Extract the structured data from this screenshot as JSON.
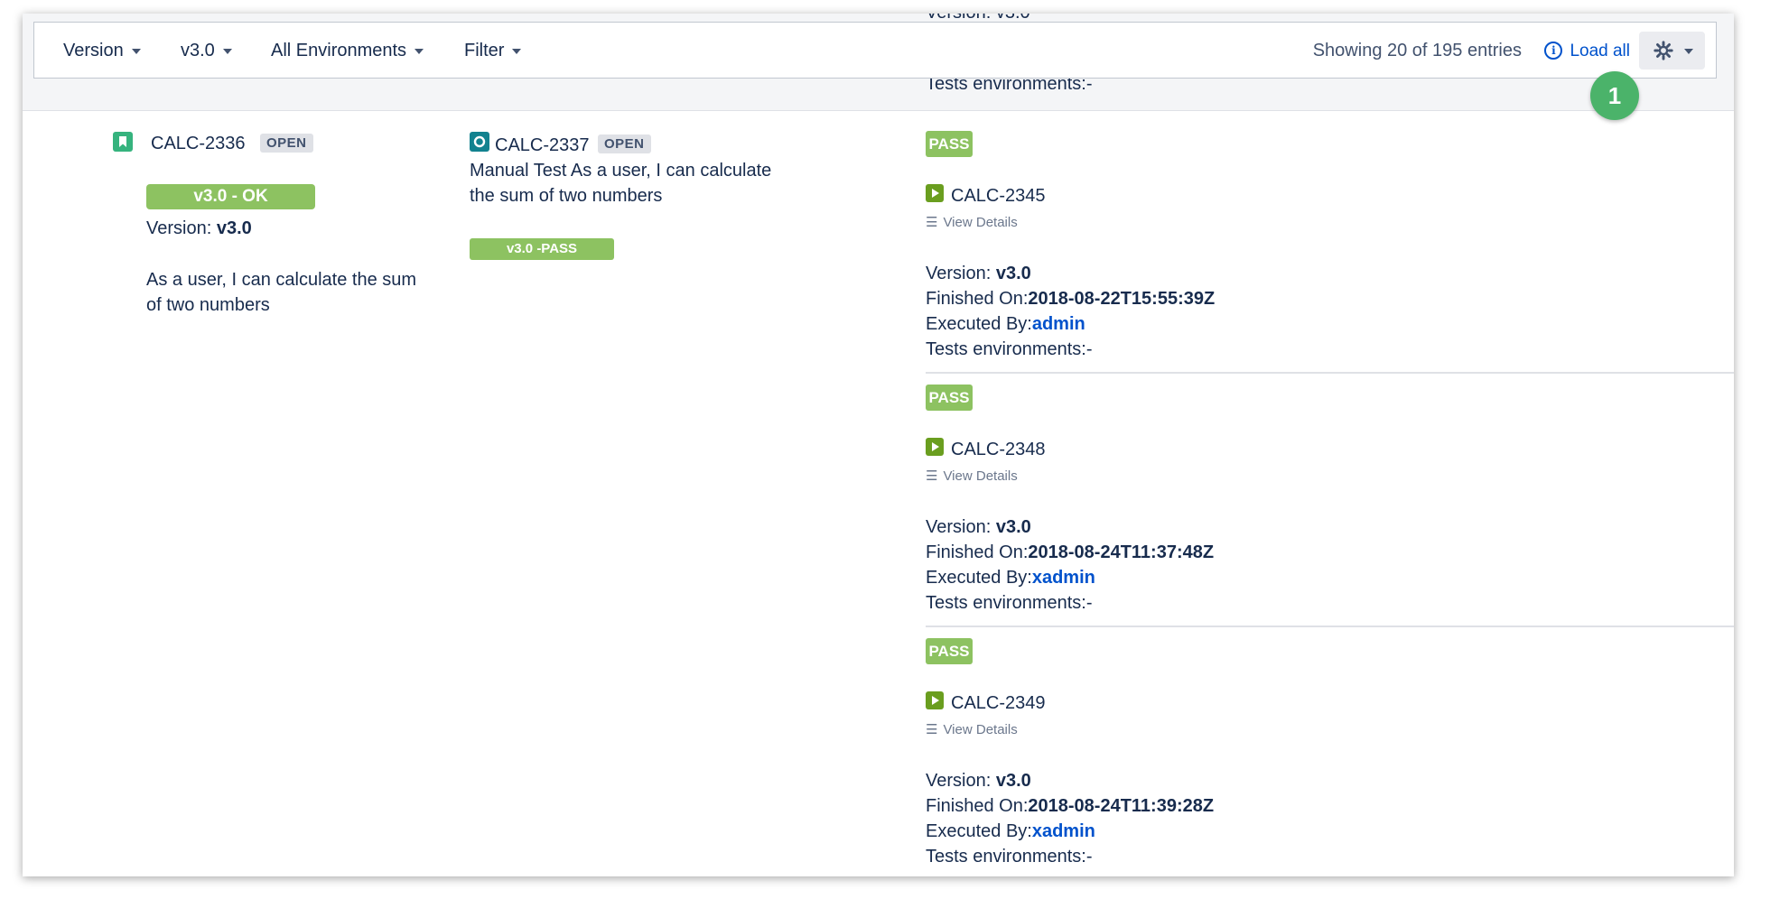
{
  "toolbar": {
    "version_dd": "Version",
    "v_dd": "v3.0",
    "env_dd": "All Environments",
    "filter_dd": "Filter",
    "showing": "Showing 20 of 195 entries",
    "load_all": "Load all"
  },
  "top_cut": {
    "version_line": "Version: v3.0",
    "env_line": "Tests environments:-"
  },
  "callout": "1",
  "story": {
    "key": "CALC-2336",
    "status": "OPEN",
    "ok_bar": "v3.0 - OK",
    "version_label": "Version: ",
    "version_value": "v3.0",
    "summary": "As a user, I can calculate the sum of two numbers"
  },
  "test": {
    "key": "CALC-2337",
    "status": "OPEN",
    "summary": "Manual Test As a user, I can calculate the sum of two numbers",
    "pass_bar": "v3.0 -PASS"
  },
  "executions": [
    {
      "status": "PASS",
      "key": "CALC-2345",
      "view": "View Details",
      "version_label": "Version: ",
      "version": "v3.0",
      "finished_label": "Finished On:",
      "finished": "2018-08-22T15:55:39Z",
      "executed_label": "Executed By:",
      "executed_by": "admin",
      "env": "Tests environments:-"
    },
    {
      "status": "PASS",
      "key": "CALC-2348",
      "view": "View Details",
      "version_label": "Version: ",
      "version": "v3.0",
      "finished_label": "Finished On:",
      "finished": "2018-08-24T11:37:48Z",
      "executed_label": "Executed By:",
      "executed_by": "xadmin",
      "env": "Tests environments:-"
    },
    {
      "status": "PASS",
      "key": "CALC-2349",
      "view": "View Details",
      "version_label": "Version: ",
      "version": "v3.0",
      "finished_label": "Finished On:",
      "finished": "2018-08-24T11:39:28Z",
      "executed_label": "Executed By:",
      "executed_by": "xadmin",
      "env": "Tests environments:-"
    }
  ]
}
